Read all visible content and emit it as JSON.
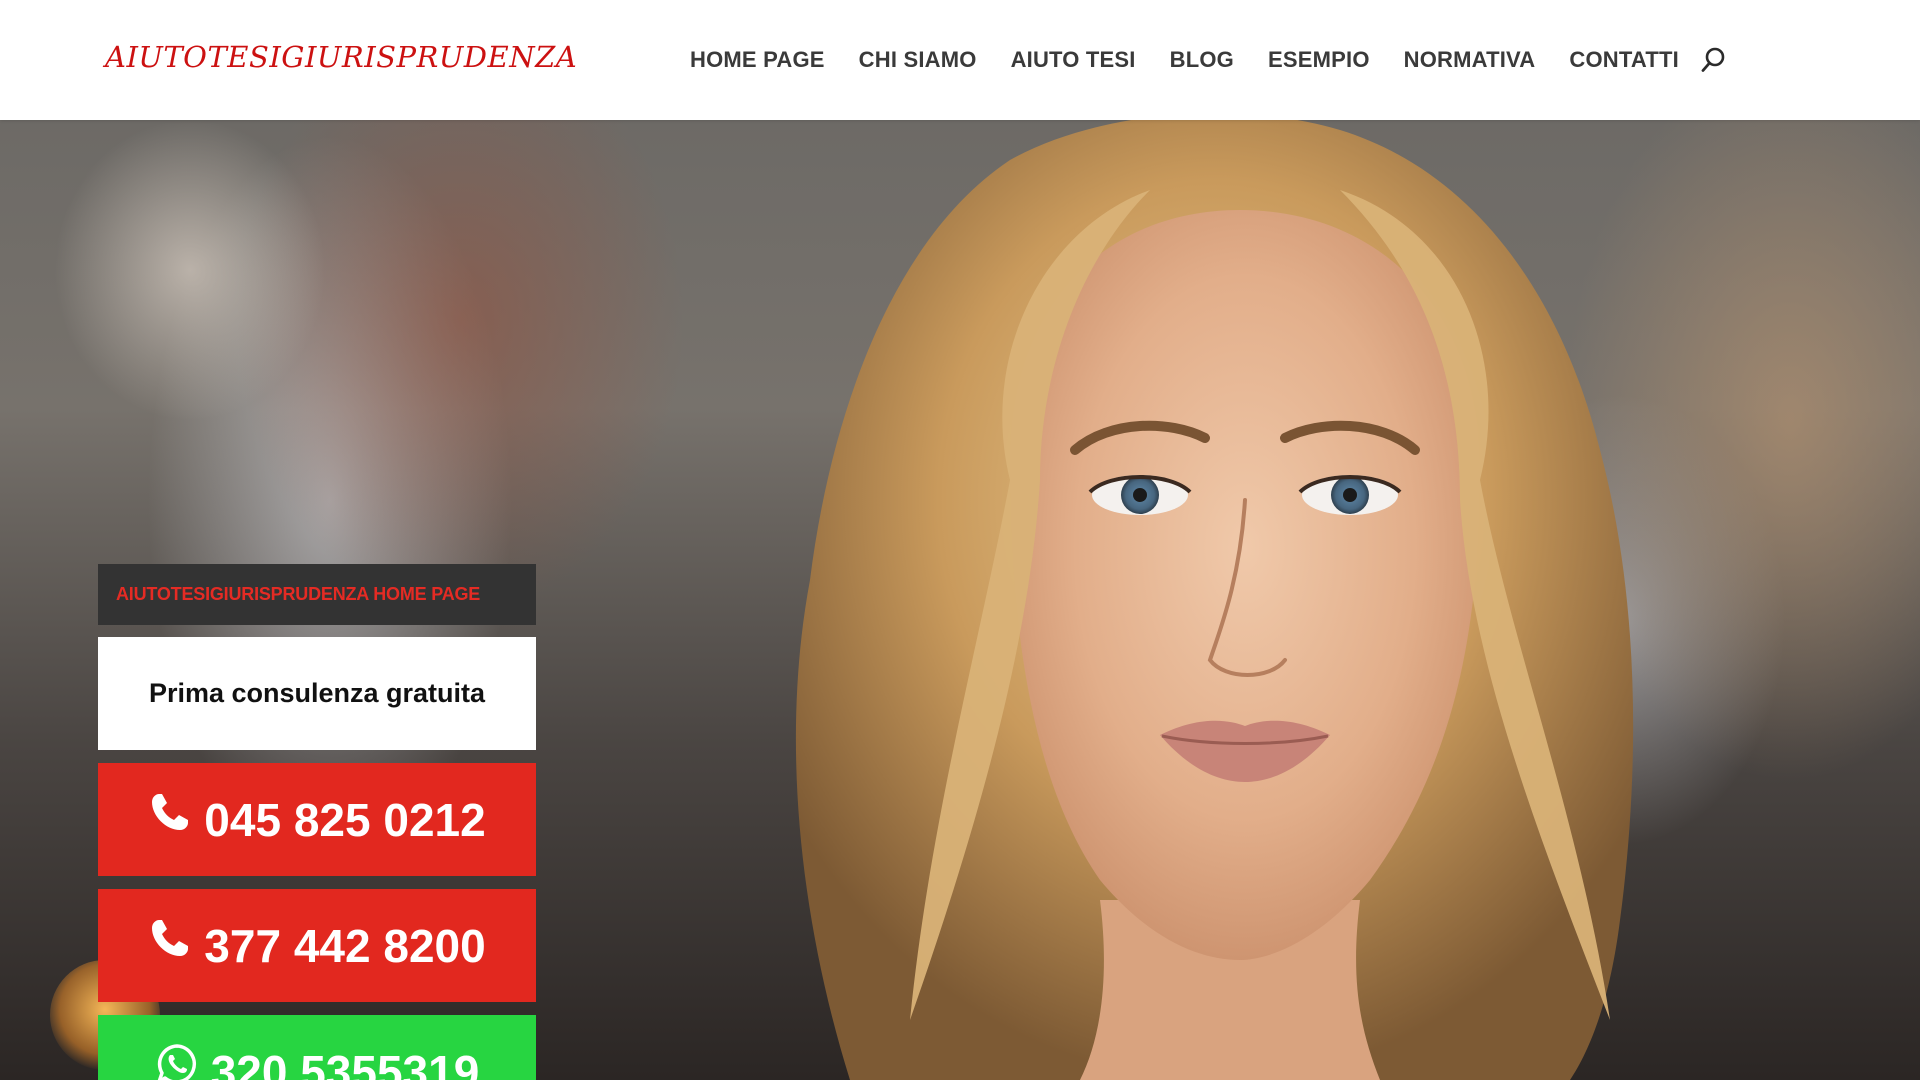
{
  "header": {
    "logo": "AIUTOTESIGIURISPRUDENZA",
    "nav": [
      {
        "label": "HOME PAGE"
      },
      {
        "label": "CHI SIAMO"
      },
      {
        "label": "AIUTO TESI"
      },
      {
        "label": "BLOG"
      },
      {
        "label": "ESEMPIO"
      },
      {
        "label": "NORMATIVA"
      },
      {
        "label": "CONTATTI"
      }
    ],
    "search_icon": "search-icon"
  },
  "hero": {
    "tag": "AIUTOTESIGIURISPRUDENZA HOME PAGE",
    "subtitle": "Prima consulenza gratuita",
    "contacts": [
      {
        "number": "045 825 0212",
        "icon": "phone-icon"
      },
      {
        "number": "377 442 8200",
        "icon": "phone-icon"
      },
      {
        "number": "320 5355319",
        "icon": "whatsapp-icon"
      }
    ]
  },
  "colors": {
    "brand_red": "#cc1111",
    "button_red": "#e2281f",
    "whatsapp_green": "#27d541",
    "tag_bg": "#333333",
    "nav_text": "#3a3a3a"
  }
}
